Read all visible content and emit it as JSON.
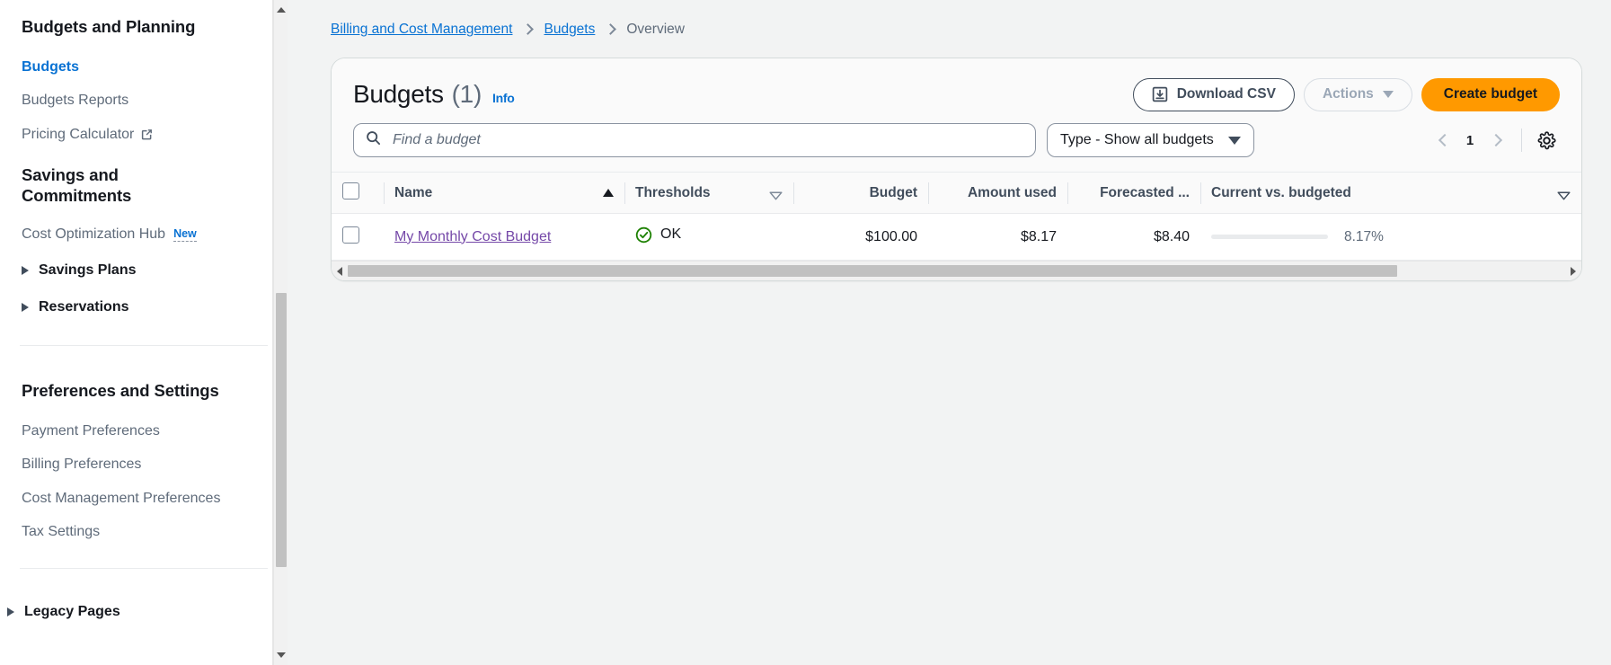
{
  "sidebar": {
    "sections": [
      {
        "title": "Budgets and Planning",
        "items": [
          {
            "label": "Budgets",
            "state": "active",
            "icon": ""
          },
          {
            "label": "Budgets Reports",
            "state": "normal",
            "icon": ""
          },
          {
            "label": "Pricing Calculator",
            "state": "external",
            "icon": "external-link-icon"
          }
        ]
      },
      {
        "title": "Savings and Commitments",
        "items": [
          {
            "label": "Cost Optimization Hub",
            "state": "badge",
            "badge": "New"
          },
          {
            "label": "Savings Plans",
            "state": "expandable"
          },
          {
            "label": "Reservations",
            "state": "expandable"
          }
        ]
      },
      {
        "title": "Preferences and Settings",
        "items": [
          {
            "label": "Payment Preferences",
            "state": "normal"
          },
          {
            "label": "Billing Preferences",
            "state": "normal"
          },
          {
            "label": "Cost Management Preferences",
            "state": "normal"
          },
          {
            "label": "Tax Settings",
            "state": "normal"
          }
        ]
      }
    ],
    "legacy": {
      "label": "Legacy Pages"
    },
    "scrollbar": {
      "up_icon": "scroll-up-arrow-icon",
      "down_icon": "scroll-down-arrow-icon"
    }
  },
  "breadcrumb": {
    "items": [
      {
        "label": "Billing and Cost Management",
        "type": "link"
      },
      {
        "label": "Budgets",
        "type": "link"
      },
      {
        "label": "Overview",
        "type": "current"
      }
    ]
  },
  "panel": {
    "title": "Budgets",
    "count": "(1)",
    "info_label": "Info",
    "buttons": {
      "download_label": "Download CSV",
      "download_icon": "download-csv-icon",
      "actions_label": "Actions",
      "actions_icon": "chevron-down-icon",
      "create_label": "Create budget"
    },
    "search": {
      "placeholder": "Find a budget",
      "value": "",
      "icon": "search-icon"
    },
    "type_filter": {
      "selected": "Type - Show all budgets",
      "icon": "chevron-down-icon"
    },
    "pagination": {
      "prev_icon": "chevron-left-icon",
      "page": "1",
      "next_icon": "chevron-right-icon",
      "settings_icon": "gear-icon"
    }
  },
  "table": {
    "columns": [
      {
        "key": "check",
        "label": ""
      },
      {
        "key": "name",
        "label": "Name",
        "sort": "asc"
      },
      {
        "key": "thresh",
        "label": "Thresholds",
        "sort": "none"
      },
      {
        "key": "budget",
        "label": "Budget",
        "sort": null
      },
      {
        "key": "used",
        "label": "Amount used",
        "sort": null
      },
      {
        "key": "fore",
        "label": "Forecasted ...",
        "sort": null
      },
      {
        "key": "cvb",
        "label": "Current vs. budgeted",
        "sort": "none"
      }
    ],
    "rows": [
      {
        "name": "My Monthly Cost Budget",
        "threshold_status": "OK",
        "threshold_icon": "status-ok-icon",
        "budget": "$100.00",
        "amount_used": "$8.17",
        "forecasted": "$8.40",
        "current_vs_budgeted_pct_label": "8.17%",
        "current_vs_budgeted_pct": 8.17
      }
    ],
    "h_scrollbar": {
      "left_icon": "scroll-left-arrow-icon",
      "right_icon": "scroll-right-arrow-icon"
    }
  },
  "colors": {
    "accent_blue": "#0972d3",
    "primary_orange": "#ff9900",
    "status_green": "#1d8102",
    "visited_link_purple": "#7548a8",
    "text_default": "#16191f",
    "text_secondary": "#5f6b7a",
    "page_background": "#f2f3f3"
  }
}
